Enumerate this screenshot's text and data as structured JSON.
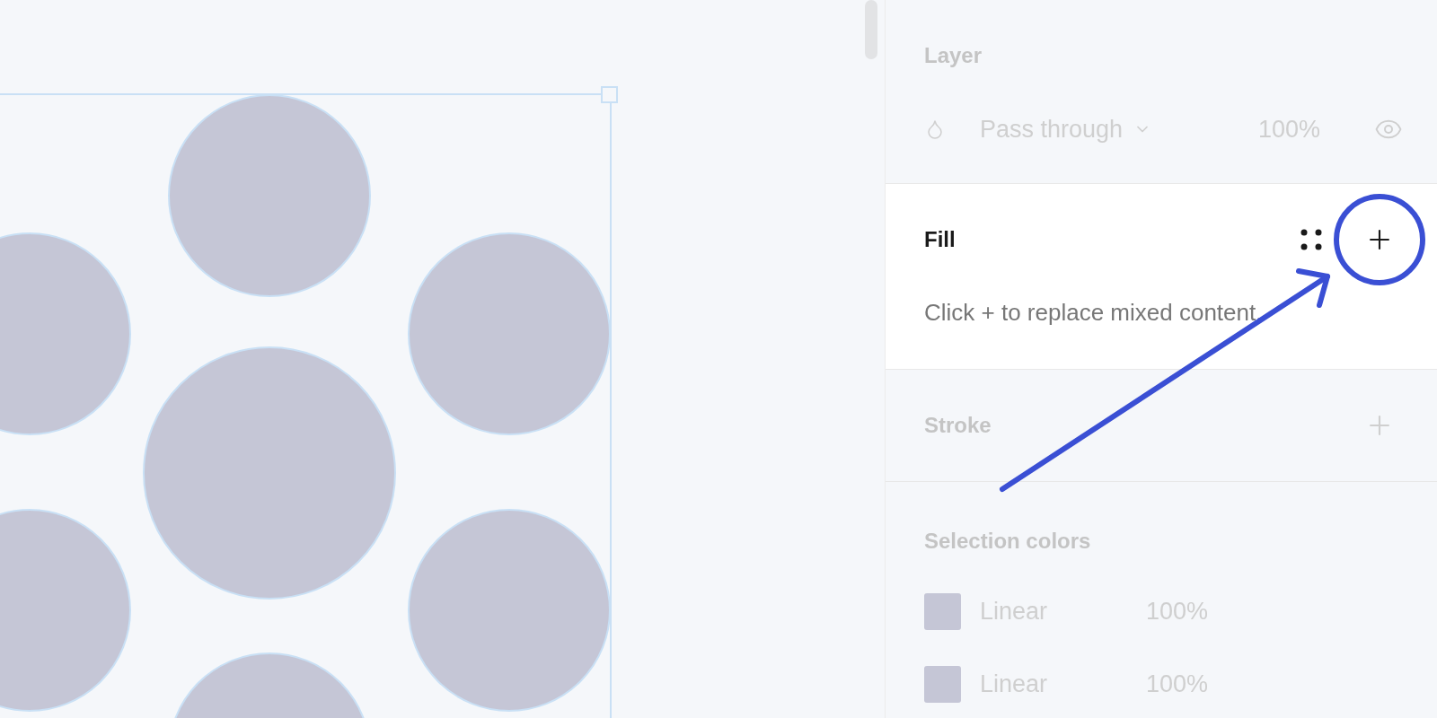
{
  "layer": {
    "title": "Layer",
    "blend_mode": "Pass through",
    "opacity": "100%",
    "visible": true,
    "highlighted": false
  },
  "fill": {
    "title": "Fill",
    "message": "Click + to replace mixed content.",
    "highlighted": true
  },
  "stroke": {
    "title": "Stroke",
    "highlighted": false
  },
  "selection_colors": {
    "title": "Selection colors",
    "highlighted": false,
    "items": [
      {
        "color": "#c5c6d6",
        "type": "Linear",
        "opacity": "100%"
      },
      {
        "color": "#c5c6d6",
        "type": "Linear",
        "opacity": "100%"
      }
    ]
  }
}
